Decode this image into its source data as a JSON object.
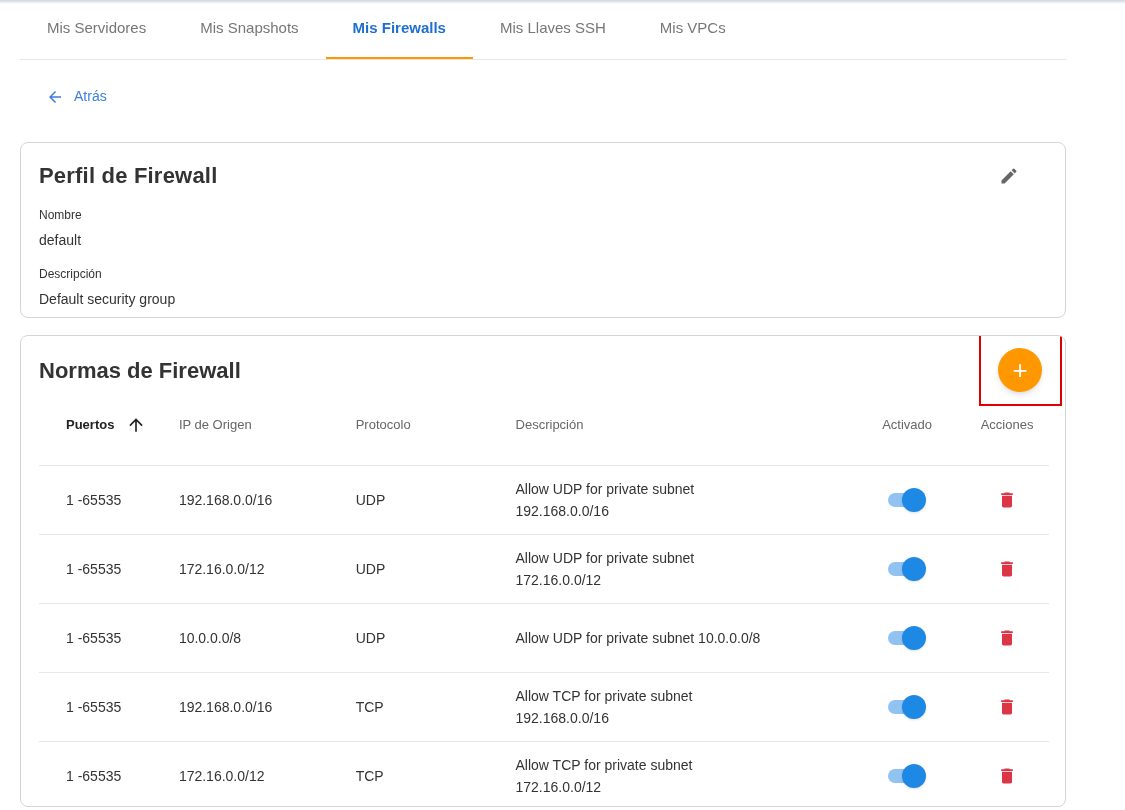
{
  "tabs": [
    {
      "label": "Mis Servidores",
      "selected": false
    },
    {
      "label": "Mis Snapshots",
      "selected": false
    },
    {
      "label": "Mis Firewalls",
      "selected": true
    },
    {
      "label": "Mis Llaves SSH",
      "selected": false
    },
    {
      "label": "Mis VPCs",
      "selected": false
    }
  ],
  "back_link": "Atrás",
  "profile": {
    "title": "Perfil de Firewall",
    "fields": [
      {
        "label": "Nombre",
        "value": "default"
      },
      {
        "label": "Descripción",
        "value": "Default security group"
      }
    ]
  },
  "rules": {
    "title": "Normas de Firewall",
    "add_button": "+",
    "highlighted": true,
    "columns": [
      {
        "label": "Puertos",
        "sorted": true
      },
      {
        "label": "IP de Origen",
        "sorted": false
      },
      {
        "label": "Protocolo",
        "sorted": false
      },
      {
        "label": "Descripción",
        "sorted": false
      },
      {
        "label": "Activado",
        "sorted": false
      },
      {
        "label": "Acciones",
        "sorted": false
      }
    ],
    "rows": [
      {
        "ports": "1 -65535",
        "ip": "192.168.0.0/16",
        "protocol": "UDP",
        "description": "Allow UDP for private subnet 192.168.0.0/16",
        "enabled": true
      },
      {
        "ports": "1 -65535",
        "ip": "172.16.0.0/12",
        "protocol": "UDP",
        "description": "Allow UDP for private subnet 172.16.0.0/12",
        "enabled": true
      },
      {
        "ports": "1 -65535",
        "ip": "10.0.0.0/8",
        "protocol": "UDP",
        "description": "Allow UDP for private subnet 10.0.0.0/8",
        "enabled": true
      },
      {
        "ports": "1 -65535",
        "ip": "192.168.0.0/16",
        "protocol": "TCP",
        "description": "Allow TCP for private subnet 192.168.0.0/16",
        "enabled": true
      },
      {
        "ports": "1 -65535",
        "ip": "172.16.0.0/12",
        "protocol": "TCP",
        "description": "Allow TCP for private subnet 172.16.0.0/12",
        "enabled": true
      }
    ]
  }
}
